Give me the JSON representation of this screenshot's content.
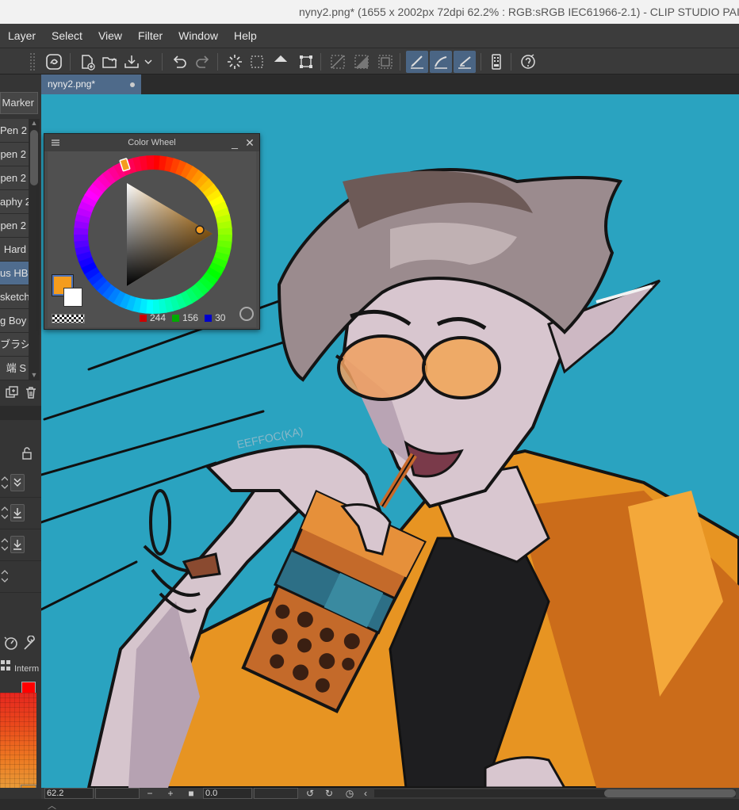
{
  "window": {
    "title": "nyny2.png* (1655 x 2002px 72dpi 62.2% : RGB:sRGB IEC61966-2.1)  - CLIP STUDIO PAINT EX"
  },
  "menu": [
    "Layer",
    "Select",
    "View",
    "Filter",
    "Window",
    "Help"
  ],
  "toolbar": {
    "buttons": [
      "clip-studio-icon",
      "new-file-icon",
      "open-file-icon",
      "save-icon",
      "undo-icon",
      "redo-icon",
      "transform-icon",
      "selection-icon",
      "fill-icon",
      "scale-icon",
      "perspective-icon",
      "grid-icon",
      "ruler-icon",
      "pen-pressure-icon",
      "brush-pressure-icon",
      "stabilizer-icon",
      "device-icon",
      "help-icon"
    ]
  },
  "document_tab": {
    "label": "nyny2.png*"
  },
  "sub_tool": {
    "group_label": "Marker",
    "items": [
      "Pen 2",
      "pen 2",
      "pen 2",
      "aphy 2",
      "pen 2",
      "Hard",
      "us HB",
      "sketch",
      "g Boy",
      "ブラシ5",
      "端 S"
    ],
    "selected_index": 6
  },
  "color_wheel": {
    "title": "Color Wheel",
    "rgb": {
      "r": "244",
      "g": "156",
      "b": "30"
    },
    "main_color": "#f49c1e",
    "sub_color": "#ffffff"
  },
  "color_set": {
    "label": "Interm"
  },
  "status": {
    "zoom": "62.2",
    "angle": "0.0"
  }
}
